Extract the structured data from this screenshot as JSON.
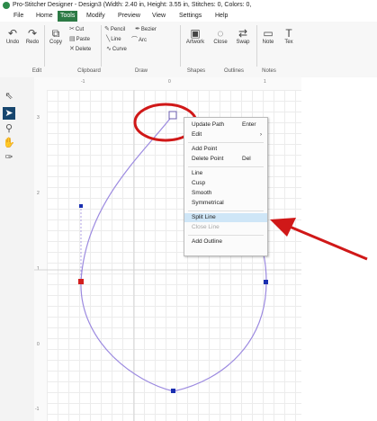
{
  "window": {
    "title": "Pro-Stitcher Designer - Design3 (Width: 2.40 in, Height: 3.55 in, Stitches: 0, Colors: 0,"
  },
  "menu": [
    "File",
    "Home",
    "Tools",
    "Modify",
    "Preview",
    "View",
    "Settings",
    "Help"
  ],
  "menu_active": "Tools",
  "ribbon": {
    "undo": "Undo",
    "redo": "Redo",
    "copy": "Copy",
    "cut": "Cut",
    "paste": "Paste",
    "delete": "Delete",
    "pencil": "Pencil",
    "bezier": "Bezier",
    "line": "Line",
    "arc": "Arc",
    "curve": "Curve",
    "artwork": "Artwork",
    "close": "Close",
    "swap": "Swap",
    "note": "Note",
    "text": "Tex",
    "groups": {
      "edit": "Edit",
      "clipboard": "Clipboard",
      "draw": "Draw",
      "shapes": "Shapes",
      "outlines": "Outlines",
      "notes": "Notes"
    }
  },
  "ruler": {
    "top_labels": [
      "-1",
      "0",
      "1"
    ],
    "left_labels": [
      "3",
      "2",
      "1",
      "0",
      "-1"
    ]
  },
  "context_menu": {
    "items": [
      {
        "label": "Update Path",
        "shortcut": "Enter",
        "submenu": false,
        "disabled": false,
        "highlighted": false
      },
      {
        "label": "Edit",
        "shortcut": "",
        "submenu": true,
        "disabled": false,
        "highlighted": false
      },
      {
        "label": "Add Point",
        "shortcut": "",
        "submenu": false,
        "disabled": false,
        "highlighted": false
      },
      {
        "label": "Delete Point",
        "shortcut": "Del",
        "submenu": false,
        "disabled": false,
        "highlighted": false
      },
      {
        "label": "Line",
        "shortcut": "",
        "submenu": false,
        "disabled": false,
        "highlighted": false
      },
      {
        "label": "Cusp",
        "shortcut": "",
        "submenu": false,
        "disabled": false,
        "highlighted": false
      },
      {
        "label": "Smooth",
        "shortcut": "",
        "submenu": false,
        "disabled": false,
        "highlighted": false
      },
      {
        "label": "Symmetrical",
        "shortcut": "",
        "submenu": false,
        "disabled": false,
        "highlighted": false
      },
      {
        "label": "Split Line",
        "shortcut": "",
        "submenu": false,
        "disabled": false,
        "highlighted": true
      },
      {
        "label": "Close Line",
        "shortcut": "",
        "submenu": false,
        "disabled": true,
        "highlighted": false
      },
      {
        "label": "Add Outline",
        "shortcut": "",
        "submenu": false,
        "disabled": false,
        "highlighted": false
      }
    ]
  },
  "icons": {
    "tools": [
      "arrow-select-icon",
      "node-select-icon",
      "zoom-icon",
      "pan-hand-icon",
      "pen-node-icon"
    ],
    "annotation": [
      "red-circle-highlight",
      "red-arrow-pointer"
    ]
  },
  "colors": {
    "menu_active": "#2c7a45",
    "path": "#9c8ae0",
    "node_blue": "#1a2fb0",
    "node_red": "#d21f1f",
    "annotation_red": "#d01818",
    "highlight": "#cfe6f7"
  }
}
